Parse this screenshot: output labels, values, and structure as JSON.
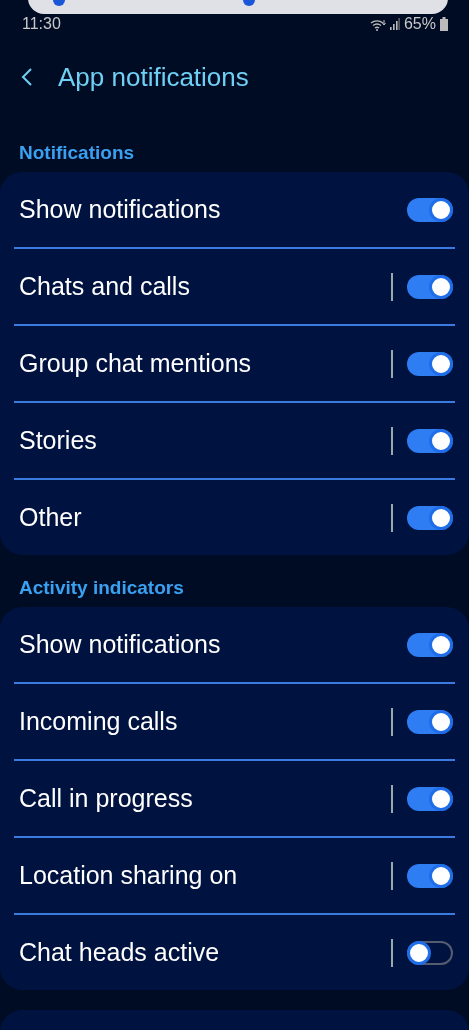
{
  "status_bar": {
    "time": "11:30",
    "battery": "65%"
  },
  "header": {
    "title": "App notifications"
  },
  "sections": [
    {
      "title": "Notifications",
      "rows": [
        {
          "label": "Show notifications",
          "kind": "master",
          "on": true
        },
        {
          "label": "Chats and calls",
          "kind": "sub",
          "on": true
        },
        {
          "label": "Group chat mentions",
          "kind": "sub",
          "on": true
        },
        {
          "label": "Stories",
          "kind": "sub",
          "on": true
        },
        {
          "label": "Other",
          "kind": "sub",
          "on": true
        }
      ]
    },
    {
      "title": "Activity indicators",
      "rows": [
        {
          "label": "Show notifications",
          "kind": "master",
          "on": true
        },
        {
          "label": "Incoming calls",
          "kind": "sub",
          "on": true
        },
        {
          "label": "Call in progress",
          "kind": "sub",
          "on": true
        },
        {
          "label": "Location sharing on",
          "kind": "sub",
          "on": true
        },
        {
          "label": "Chat heads active",
          "kind": "sub",
          "on": false
        }
      ]
    }
  ]
}
